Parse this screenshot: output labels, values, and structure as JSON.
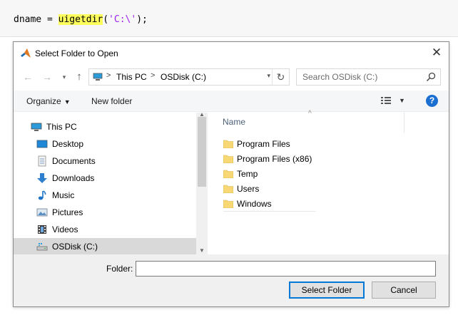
{
  "code": {
    "prefix": "dname = ",
    "function": "uigetdir",
    "open_paren": "(",
    "argument": "'C:\\'",
    "suffix": ");"
  },
  "dialog": {
    "title": "Select Folder to Open",
    "close_glyph": "✕"
  },
  "address_bar": {
    "segments": [
      "This PC",
      "OSDisk (C:)"
    ],
    "separator": ">"
  },
  "search": {
    "placeholder": "Search OSDisk (C:)"
  },
  "toolbar": {
    "organize_label": "Organize",
    "new_folder_label": "New folder",
    "help_label": "?"
  },
  "nav_tree": {
    "items": [
      {
        "label": "This PC",
        "icon": "computer-icon"
      },
      {
        "label": "Desktop",
        "icon": "desktop-icon"
      },
      {
        "label": "Documents",
        "icon": "documents-icon"
      },
      {
        "label": "Downloads",
        "icon": "downloads-icon"
      },
      {
        "label": "Music",
        "icon": "music-icon"
      },
      {
        "label": "Pictures",
        "icon": "pictures-icon"
      },
      {
        "label": "Videos",
        "icon": "videos-icon"
      },
      {
        "label": "OSDisk (C:)",
        "icon": "drive-icon",
        "selected": true
      }
    ]
  },
  "file_list": {
    "column_name": "Name",
    "items": [
      "Program Files",
      "Program Files (x86)",
      "Temp",
      "Users",
      "Windows"
    ]
  },
  "footer": {
    "folder_label": "Folder:",
    "folder_value": "",
    "select_button": "Select Folder",
    "cancel_button": "Cancel"
  },
  "colors": {
    "highlight": "#ffff5c",
    "string": "#a020f0",
    "folder": "#f8d775",
    "selection": "#d9d9d9",
    "accent": "#0078d7"
  }
}
